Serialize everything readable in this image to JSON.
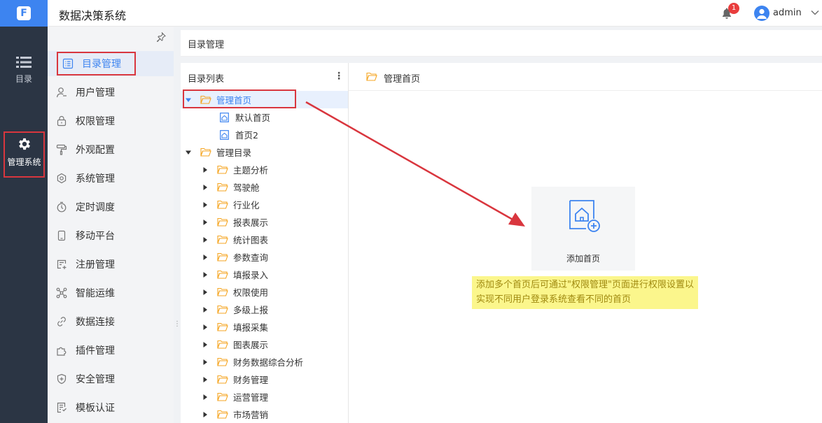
{
  "app": {
    "title": "数据决策系统"
  },
  "rail": {
    "items": [
      {
        "label": "目录",
        "icon": "list-icon"
      },
      {
        "label": "管理系统",
        "icon": "gear-icon"
      }
    ]
  },
  "topbar": {
    "notification_count": "1",
    "user_name": "admin"
  },
  "menu": {
    "items": [
      {
        "label": "目录管理",
        "icon": "catalog-icon",
        "active": true
      },
      {
        "label": "用户管理",
        "icon": "user-icon"
      },
      {
        "label": "权限管理",
        "icon": "lock-icon"
      },
      {
        "label": "外观配置",
        "icon": "paint-roller-icon"
      },
      {
        "label": "系统管理",
        "icon": "settings-icon"
      },
      {
        "label": "定时调度",
        "icon": "timer-icon"
      },
      {
        "label": "移动平台",
        "icon": "mobile-icon"
      },
      {
        "label": "注册管理",
        "icon": "register-icon"
      },
      {
        "label": "智能运维",
        "icon": "ops-icon"
      },
      {
        "label": "数据连接",
        "icon": "link-icon"
      },
      {
        "label": "插件管理",
        "icon": "plugin-icon"
      },
      {
        "label": "安全管理",
        "icon": "shield-icon"
      },
      {
        "label": "模板认证",
        "icon": "template-icon"
      }
    ]
  },
  "breadcrumb": "目录管理",
  "tree": {
    "header": "目录列表",
    "more_icon": "⋮",
    "rows": [
      {
        "label": "管理首页",
        "level": 0,
        "type": "folder",
        "expanded": true,
        "selected": true
      },
      {
        "label": "默认首页",
        "level": 1,
        "type": "page"
      },
      {
        "label": "首页2",
        "level": 1,
        "type": "page"
      },
      {
        "label": "管理目录",
        "level": 0,
        "type": "folder",
        "expanded": true
      },
      {
        "label": "主题分析",
        "level": 1,
        "type": "folder"
      },
      {
        "label": "驾驶舱",
        "level": 1,
        "type": "folder"
      },
      {
        "label": "行业化",
        "level": 1,
        "type": "folder"
      },
      {
        "label": "报表展示",
        "level": 1,
        "type": "folder"
      },
      {
        "label": "统计图表",
        "level": 1,
        "type": "folder"
      },
      {
        "label": "参数查询",
        "level": 1,
        "type": "folder"
      },
      {
        "label": "填报录入",
        "level": 1,
        "type": "folder"
      },
      {
        "label": "权限使用",
        "level": 1,
        "type": "folder"
      },
      {
        "label": "多级上报",
        "level": 1,
        "type": "folder"
      },
      {
        "label": "填报采集",
        "level": 1,
        "type": "folder"
      },
      {
        "label": "图表展示",
        "level": 1,
        "type": "folder"
      },
      {
        "label": "财务数据综合分析",
        "level": 1,
        "type": "folder"
      },
      {
        "label": "财务管理",
        "level": 1,
        "type": "folder"
      },
      {
        "label": "运营管理",
        "level": 1,
        "type": "folder"
      },
      {
        "label": "市场营销",
        "level": 1,
        "type": "folder"
      }
    ]
  },
  "main": {
    "title": "管理首页",
    "add_label": "添加首页",
    "note": "添加多个首页后可通过\"权限管理\"页面进行权限设置以实现不同用户登录系统查看不同的首页"
  },
  "colors": {
    "accent": "#3d84f0",
    "rail_bg": "#2b3544",
    "folder": "#f5a623",
    "highlight": "#d9363e",
    "note_bg": "#fbf68c"
  }
}
